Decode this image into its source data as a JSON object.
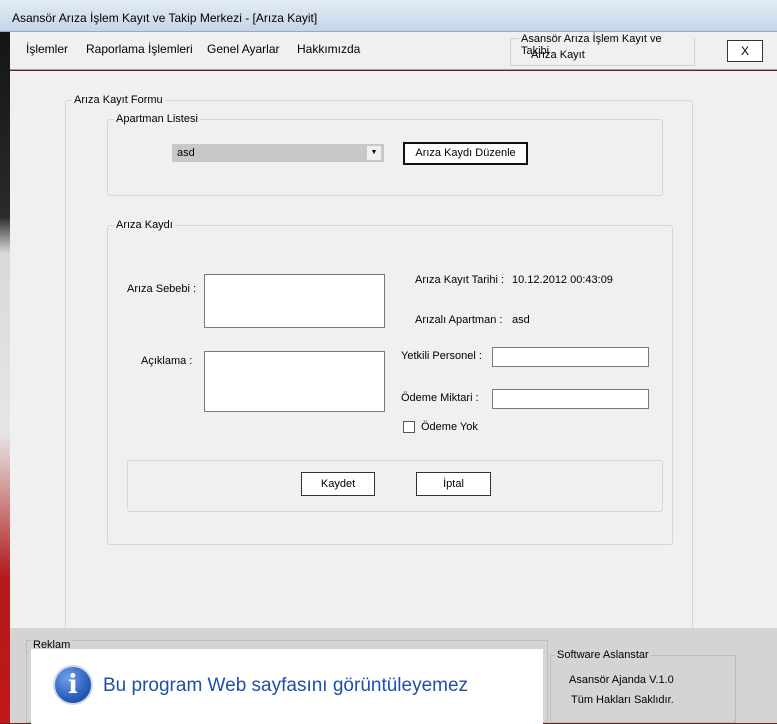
{
  "window": {
    "title": "Asansör Arıza İşlem Kayıt ve Takip Merkezi - [Arıza Kayit]"
  },
  "menu": {
    "items": [
      "İşlemler",
      "Raporlama İşlemleri",
      "Genel Ayarlar",
      "Hakkımızda"
    ]
  },
  "header_info": {
    "legend": "Asansör Arıza İşlem Kayıt ve Takibi",
    "subtitle": "Arıza Kayıt",
    "close_label": "X"
  },
  "form": {
    "legend": "Arıza Kayıt Formu",
    "apartman": {
      "legend": "Apartman Listesi",
      "selected": "asd",
      "edit_button": "Arıza Kaydı Düzenle"
    },
    "kayit": {
      "legend": "Arıza Kaydı",
      "sebep_label": "Arıza Sebebi :",
      "sebep_value": "",
      "aciklama_label": "Açıklama :",
      "aciklama_value": "",
      "tarih_label": "Arıza Kayıt Tarihi :",
      "tarih_value": "10.12.2012 00:43:09",
      "apartman_label": "Arızalı Apartman :",
      "apartman_value": "asd",
      "personel_label": "Yetkili Personel :",
      "personel_value": "",
      "odeme_label": "Ödeme Miktari  :",
      "odeme_value": "",
      "odeme_yok_label": "Ödeme Yok",
      "odeme_yok_checked": false,
      "save_button": "Kaydet",
      "cancel_button": "İptal"
    }
  },
  "footer": {
    "reklam_legend": "Reklam",
    "reklam_message": "Bu program Web sayfasını görüntüleyemez",
    "software_legend": "Software Aslanstar",
    "version": "Asansör Ajanda V.1.0",
    "rights": "Tüm Hakları Saklıdır."
  },
  "icons": {
    "info": "info-icon",
    "dropdown": "dropdown-arrow-icon"
  },
  "colors": {
    "accent": "#1f4fa8",
    "titlebar": "#c5d5e8"
  }
}
